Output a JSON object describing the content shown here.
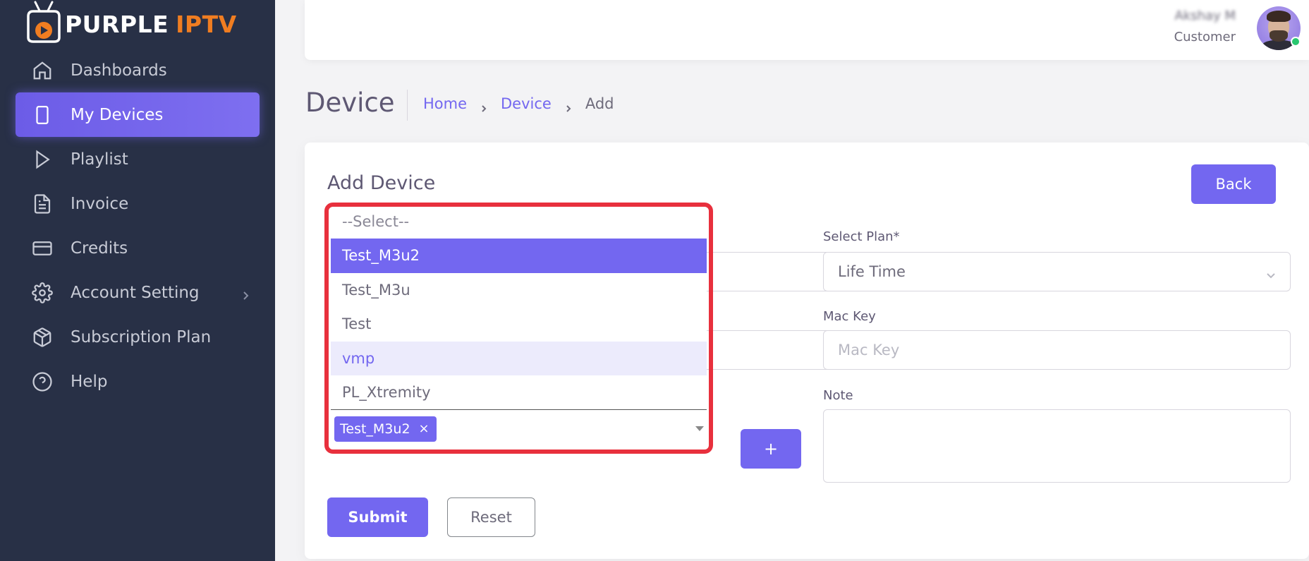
{
  "brand": {
    "part1": "PURPLE",
    "part2": "IPTV",
    "color_white": "#ffffff",
    "color_orange": "#f07d21",
    "icon": "tv-play-icon"
  },
  "sidebar": {
    "items": [
      {
        "label": "Dashboards",
        "icon": "home-icon",
        "active": false
      },
      {
        "label": "My Devices",
        "icon": "smartphone-icon",
        "active": true
      },
      {
        "label": "Playlist",
        "icon": "play-icon",
        "active": false
      },
      {
        "label": "Invoice",
        "icon": "file-text-icon",
        "active": false
      },
      {
        "label": "Credits",
        "icon": "credit-card-icon",
        "active": false
      },
      {
        "label": "Account Setting",
        "icon": "gear-icon",
        "active": false,
        "has_submenu": true
      },
      {
        "label": "Subscription Plan",
        "icon": "package-icon",
        "active": false
      },
      {
        "label": "Help",
        "icon": "help-circle-icon",
        "active": false
      }
    ]
  },
  "header": {
    "user_name": "Akshay M",
    "user_role": "Customer",
    "status": "online"
  },
  "page": {
    "title": "Device",
    "breadcrumb": [
      "Home",
      "Device",
      "Add"
    ]
  },
  "form": {
    "title": "Add Device",
    "back_label": "Back",
    "select_plan_label": "Select Plan*",
    "select_plan_value": "Life Time",
    "mac_key_label": "Mac Key",
    "mac_key_placeholder": "Mac Key",
    "note_label": "Note",
    "note_value": "",
    "add_button_label": "+",
    "submit_label": "Submit",
    "reset_label": "Reset"
  },
  "playlist_dropdown": {
    "placeholder": "--Select--",
    "options": [
      "Test_M3u2",
      "Test_M3u",
      "Test",
      "vmp",
      "PL_Xtremity"
    ],
    "selected": "Test_M3u2",
    "hovered": "vmp",
    "selected_chips": [
      "Test_M3u2"
    ],
    "chip_remove": "×"
  },
  "colors": {
    "accent": "#7367f0",
    "sidebar_bg": "#283046",
    "highlight": "#e8303d",
    "online": "#28c76f"
  }
}
